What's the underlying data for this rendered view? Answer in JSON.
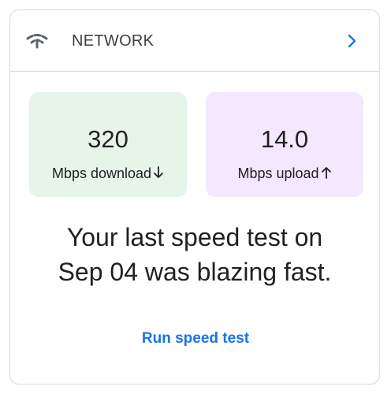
{
  "header": {
    "icon": "network-icon",
    "title": "NETWORK",
    "chevron_icon": "chevron-right-icon"
  },
  "stats": {
    "download": {
      "value": "320",
      "label": "Mbps download",
      "icon": "arrow-down-icon",
      "background": "#e6f4ea"
    },
    "upload": {
      "value": "14.0",
      "label": "Mbps upload",
      "icon": "arrow-up-icon",
      "background": "#f3e8fd"
    }
  },
  "message": {
    "line1": "Your last speed test on",
    "line2": "Sep 04 was blazing fast."
  },
  "action": {
    "label": "Run speed test",
    "color": "#1a73e8"
  }
}
